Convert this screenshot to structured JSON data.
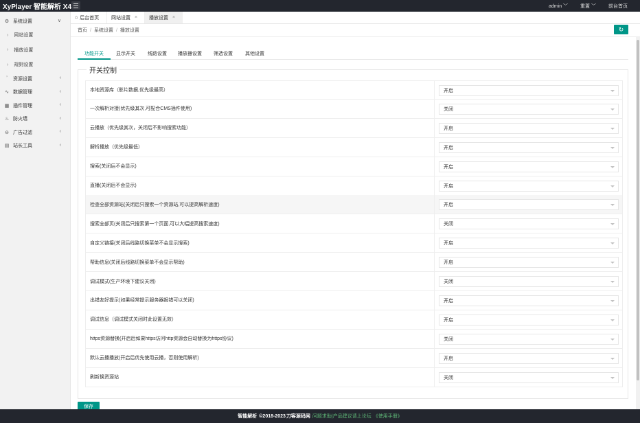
{
  "app": {
    "logo": "XyPlayer 智能解析 X4",
    "user": "admin",
    "reset": "重置",
    "front": "前台首页"
  },
  "sidebar": {
    "items": [
      {
        "label": "系统设置",
        "icon": "gear-icon",
        "expanded": true
      },
      {
        "label": "资源设置",
        "icon": "rss-icon"
      },
      {
        "label": "数据管理",
        "icon": "pulse-icon"
      },
      {
        "label": "插件管理",
        "icon": "grid-icon"
      },
      {
        "label": "防火墙",
        "icon": "flame-icon"
      },
      {
        "label": "广告过滤",
        "icon": "minus-circle-icon"
      },
      {
        "label": "站长工具",
        "icon": "toolbox-icon"
      }
    ],
    "sub": [
      "网站设置",
      "播放设置",
      "规则设置"
    ]
  },
  "tabs": [
    {
      "label": "后台首页",
      "icon": "home-icon"
    },
    {
      "label": "网站设置"
    },
    {
      "label": "播放设置"
    }
  ],
  "breadcrumb": [
    "首页",
    "系统设置",
    "播放设置"
  ],
  "subtabs": [
    "功能开关",
    "显示开关",
    "线路设置",
    "播放器设置",
    "筛选设置",
    "其他设置"
  ],
  "section_title": "开关控制",
  "rows": [
    {
      "label": "本地资源库（影片数据,优先级最高）",
      "value": "开启"
    },
    {
      "label": "一次解析对接(优先级其次,可配合CMS插件使用)",
      "value": "关闭"
    },
    {
      "label": "云播放（优先级其次，关闭后不影响搜索功能）",
      "value": "开启"
    },
    {
      "label": "解析播放（优先级最低）",
      "value": "开启"
    },
    {
      "label": "搜索(关闭后不会显示)",
      "value": "开启"
    },
    {
      "label": "直播(关闭后不会显示)",
      "value": "开启"
    },
    {
      "label": "检查全部资源站(关闭后只搜索一个资源站,可以提高解析速度)",
      "value": "开启"
    },
    {
      "label": "搜索全部页(关闭后只搜索第一个页面,可以大幅提高搜索速度)",
      "value": "关闭"
    },
    {
      "label": "自定义链接(关闭后线路切换菜单不会显示搜索)",
      "value": "开启"
    },
    {
      "label": "帮助信息(关闭后线路切换菜单不会显示帮助)",
      "value": "开启"
    },
    {
      "label": "调试模式(生产环境下建议关闭)",
      "value": "关闭"
    },
    {
      "label": "出错友好提示(如果经常提示服务器报错可以关闭)",
      "value": "开启"
    },
    {
      "label": "调试信息（调试模式关闭时此设置无效）",
      "value": "开启"
    },
    {
      "label": "https资源替换(开启后如果https访问http资源会自动替换为https协议)",
      "value": "关闭"
    },
    {
      "label": "默认云播播放(开启后优先使用云播，否则使用解析)",
      "value": "开启"
    },
    {
      "label": "刷新换资源站",
      "value": "关闭"
    }
  ],
  "save_label": "保存",
  "footer": {
    "brand": "智能解析",
    "copyright": "©2018-2023",
    "site": "刀客源码网",
    "notice": "问题求助|产品建议请上论坛",
    "manual": "《使用手册》"
  },
  "colors": {
    "accent": "#009688",
    "topbar": "#23262e",
    "link": "#5fb878"
  }
}
